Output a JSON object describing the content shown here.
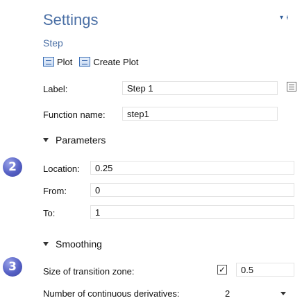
{
  "header": {
    "title": "Settings",
    "pin_glyph": "▾ ᵻ"
  },
  "subtitle": "Step",
  "toolbar": {
    "plot_label": "Plot",
    "create_plot_label": "Create Plot"
  },
  "fields": {
    "label_label": "Label:",
    "label_value": "Step 1",
    "function_name_label": "Function name:",
    "function_name_value": "step1"
  },
  "sections": {
    "parameters": "Parameters",
    "smoothing": "Smoothing"
  },
  "parameters": {
    "location_label": "Location:",
    "location_value": "0.25",
    "from_label": "From:",
    "from_value": "0",
    "to_label": "To:",
    "to_value": "1"
  },
  "smoothing": {
    "transition_label": "Size of transition zone:",
    "transition_checked": true,
    "transition_check_glyph": "✓",
    "transition_value": "0.5",
    "derivatives_label": "Number of continuous derivatives:",
    "derivatives_value": "2"
  },
  "badges": {
    "two": "2",
    "three": "3"
  },
  "colors": {
    "title_blue": "#4a6fa5",
    "badge": "#5560c4"
  }
}
